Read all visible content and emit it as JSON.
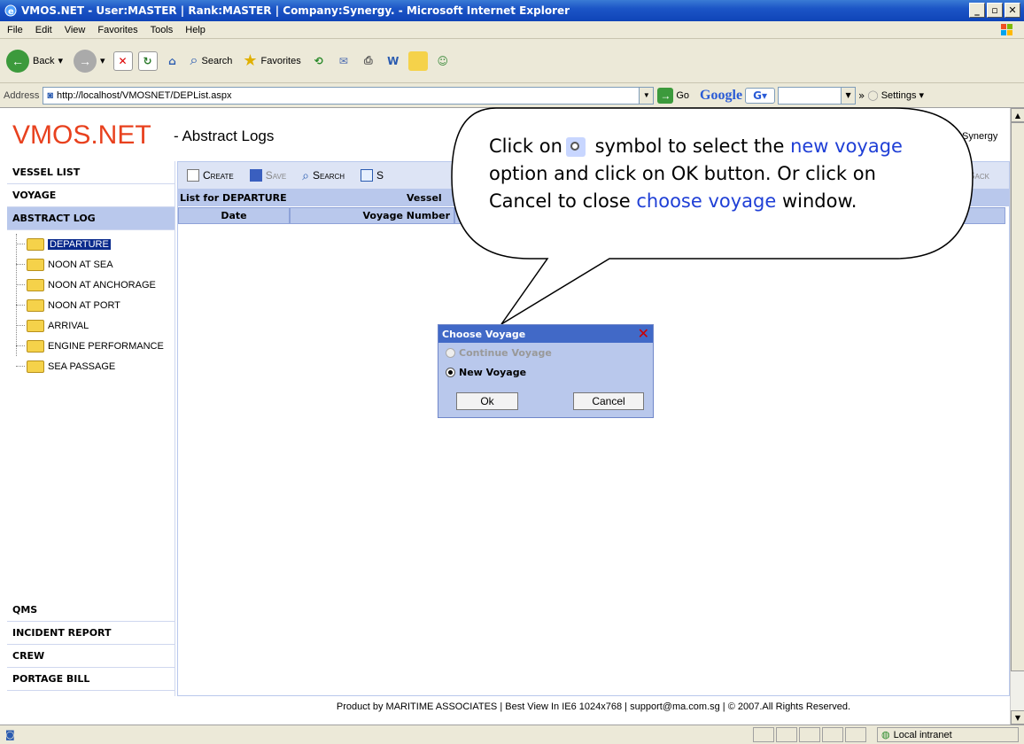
{
  "window": {
    "title": "VMOS.NET - User:MASTER | Rank:MASTER | Company:Synergy. - Microsoft Internet Explorer"
  },
  "menu": [
    "File",
    "Edit",
    "View",
    "Favorites",
    "Tools",
    "Help"
  ],
  "toolbar": {
    "back": "Back",
    "search": "Search",
    "favorites": "Favorites"
  },
  "address": {
    "label": "Address",
    "url": "http://localhost/VMOSNET/DEPList.aspx",
    "go": "Go",
    "google": "Google",
    "settings": "Settings"
  },
  "header": {
    "brand": "VMOS.NET",
    "subtitle": "- Abstract Logs",
    "company": "Synergy"
  },
  "nav": {
    "top": [
      "VESSEL LIST",
      "VOYAGE",
      "ABSTRACT LOG"
    ],
    "tree": [
      "DEPARTURE",
      "NOON AT SEA",
      "NOON AT ANCHORAGE",
      "NOON AT PORT",
      "ARRIVAL",
      "ENGINE PERFORMANCE",
      "SEA PASSAGE"
    ],
    "bottom": [
      "QMS",
      "INCIDENT REPORT",
      "CREW",
      "PORTAGE BILL"
    ]
  },
  "commands": {
    "create": "Create",
    "save": "Save",
    "search": "Search",
    "s": "S",
    "back": "Back"
  },
  "list": {
    "title": "List for DEPARTURE",
    "vessel": "Vessel",
    "col_date": "Date",
    "col_voyage": "Voyage Number"
  },
  "dialog": {
    "title": "Choose Voyage",
    "opt_continue": "Continue Voyage",
    "opt_new": "New Voyage",
    "ok": "Ok",
    "cancel": "Cancel"
  },
  "callout": {
    "p1": "Click on",
    "p2": "symbol to select the",
    "hl1": "new voyage",
    "p3": "option and click on OK button. Or click on Cancel to close",
    "hl2": "choose voyage",
    "p4": "window."
  },
  "footer": "Product by MARITIME ASSOCIATES | Best View In IE6 1024x768 | support@ma.com.sg | © 2007.All Rights Reserved.",
  "status": {
    "zone": "Local intranet"
  },
  "colors": {
    "brand": "#e8411e",
    "titlebar": "#1c55c6",
    "panel": "#b9c8ec",
    "highlight": "#1f3fd6"
  }
}
